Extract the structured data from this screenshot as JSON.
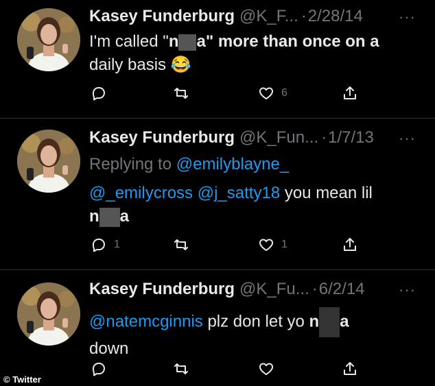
{
  "tweets": [
    {
      "name": "Kasey Funderburg",
      "handle": "@K_F...",
      "dot": "·",
      "date": "2/28/14",
      "more": "···",
      "text_a": "I'm called \"",
      "text_n": "n",
      "text_after": "a\" more than once on a",
      "text_line2": "daily basis",
      "emoji": "😂",
      "likes": "6"
    },
    {
      "name": "Kasey Funderburg",
      "handle": "@K_Fun...",
      "dot": "·",
      "date": "1/7/13",
      "more": "···",
      "replying_prefix": "Replying to ",
      "replying_handle": "@emilyblayne_",
      "mention1": "@_emilycross",
      "mention2": "@j_satty18",
      "text": " you mean lil",
      "text_n": "n",
      "text_after": "a",
      "replies": "1",
      "likes": "1"
    },
    {
      "name": "Kasey Funderburg",
      "handle": "@K_Fu...",
      "dot": "·",
      "date": "6/2/14",
      "more": "···",
      "mention": "@natemcginnis",
      "text": " plz don let yo ",
      "text_n": "n",
      "text_after": "a",
      "text_line2": "down"
    }
  ],
  "watermark": "© Twitter"
}
